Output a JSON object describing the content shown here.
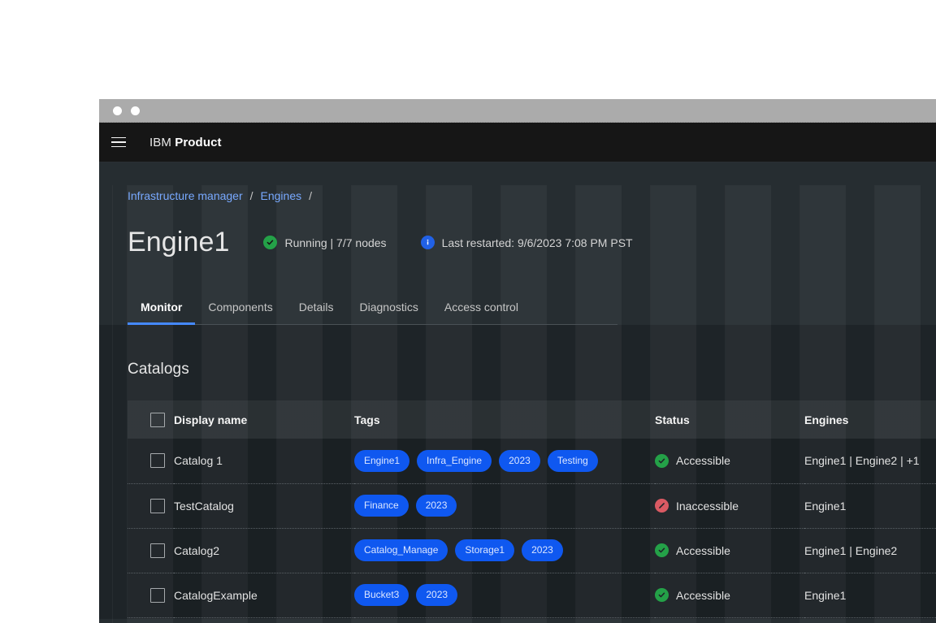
{
  "window": {
    "titlebar_dots": [
      "dot-1",
      "dot-2"
    ]
  },
  "topnav": {
    "menu_icon": "hamburger-menu-icon",
    "brand_light": "IBM",
    "brand_bold": "Product"
  },
  "breadcrumb": {
    "items": [
      {
        "label": "Infrastructure manager"
      },
      {
        "label": "Engines"
      }
    ],
    "separator": "/"
  },
  "page": {
    "title": "Engine1",
    "status": {
      "icon": "check-circle-icon",
      "color": "#24a148",
      "text": "Running | 7/7 nodes"
    },
    "info": {
      "icon": "information-icon",
      "color": "#2161e6",
      "text": "Last restarted: 9/6/2023 7:08 PM PST"
    }
  },
  "tabs": [
    {
      "label": "Monitor",
      "active": true
    },
    {
      "label": "Components",
      "active": false
    },
    {
      "label": "Details",
      "active": false
    },
    {
      "label": "Diagnostics",
      "active": false
    },
    {
      "label": "Access control",
      "active": false
    }
  ],
  "section": {
    "title": "Catalogs"
  },
  "table": {
    "columns": [
      {
        "key": "check",
        "label": ""
      },
      {
        "key": "name",
        "label": "Display name"
      },
      {
        "key": "tags",
        "label": "Tags"
      },
      {
        "key": "status",
        "label": "Status"
      },
      {
        "key": "engines",
        "label": "Engines"
      }
    ],
    "rows": [
      {
        "name": "Catalog 1",
        "tags": [
          "Engine1",
          "Infra_Engine",
          "2023",
          "Testing"
        ],
        "status": "Accessible",
        "status_icon": "check-circle-icon",
        "status_color": "#24a148",
        "engines": "Engine1 | Engine2 | +1"
      },
      {
        "name": "TestCatalog",
        "tags": [
          "Finance",
          "2023"
        ],
        "status": "Inaccessible",
        "status_icon": "no-entry-icon",
        "status_color": "#da5a63",
        "engines": "Engine1"
      },
      {
        "name": "Catalog2",
        "tags": [
          "Catalog_Manage",
          "Storage1",
          "2023"
        ],
        "status": "Accessible",
        "status_icon": "check-circle-icon",
        "status_color": "#24a148",
        "engines": "Engine1 | Engine2"
      },
      {
        "name": "CatalogExample",
        "tags": [
          "Bucket3",
          "2023"
        ],
        "status": "Accessible",
        "status_icon": "check-circle-icon",
        "status_color": "#24a148",
        "engines": "Engine1"
      }
    ]
  },
  "colors": {
    "accent_blue": "#4589ff",
    "link_blue": "#78a9ff",
    "tag_blue": "#0f58f0",
    "success_green": "#24a148",
    "error_red": "#da5a63",
    "app_bg": "#161616",
    "content_bg": "#262d31",
    "lower_bg": "#1e2428"
  }
}
